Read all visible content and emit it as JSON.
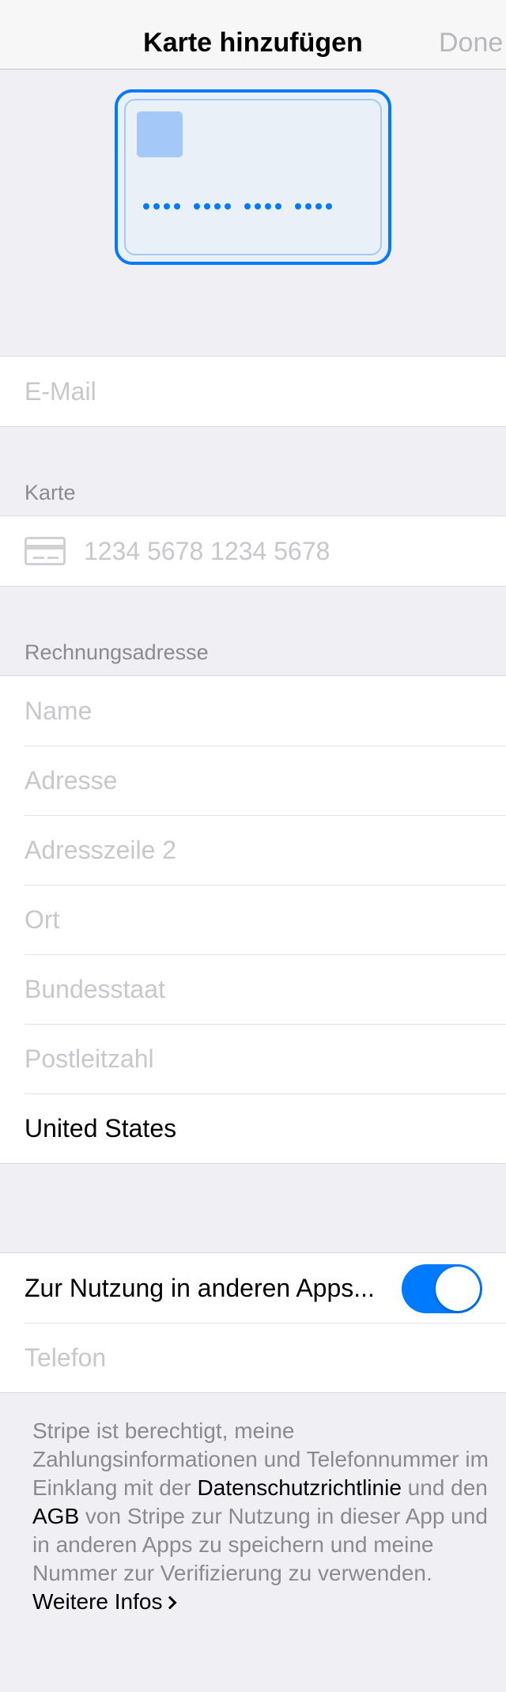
{
  "navbar": {
    "title": "Karte hinzufügen",
    "done_label": "Done"
  },
  "email": {
    "placeholder": "E-Mail"
  },
  "card_section": {
    "header": "Karte",
    "number_placeholder": "1234 5678 1234 5678"
  },
  "billing": {
    "header": "Rechnungsadresse",
    "name_placeholder": "Name",
    "address_placeholder": "Adresse",
    "address2_placeholder": "Adresszeile 2",
    "city_placeholder": "Ort",
    "state_placeholder": "Bundesstaat",
    "zip_placeholder": "Postleitzahl",
    "country_value": "United States"
  },
  "link": {
    "toggle_label": "Zur Nutzung in anderen Apps...",
    "toggle_on": true,
    "phone_placeholder": "Telefon"
  },
  "footer": {
    "text_1": "Stripe ist berechtigt, meine Zahlungsinformationen und Telefonnummer im Einklang mit der ",
    "privacy_link": "Datenschutzrichtlinie",
    "text_2": " und den ",
    "terms_link": "AGB",
    "text_3": " von Stripe zur Nutzung in dieser App und in anderen Apps zu speichern und meine Nummer zur Verifizierung zu verwenden.",
    "more_info_link": "Weitere Infos"
  },
  "colors": {
    "accent": "#007aff",
    "background": "#efeff4",
    "placeholder": "#c7c7cd"
  }
}
